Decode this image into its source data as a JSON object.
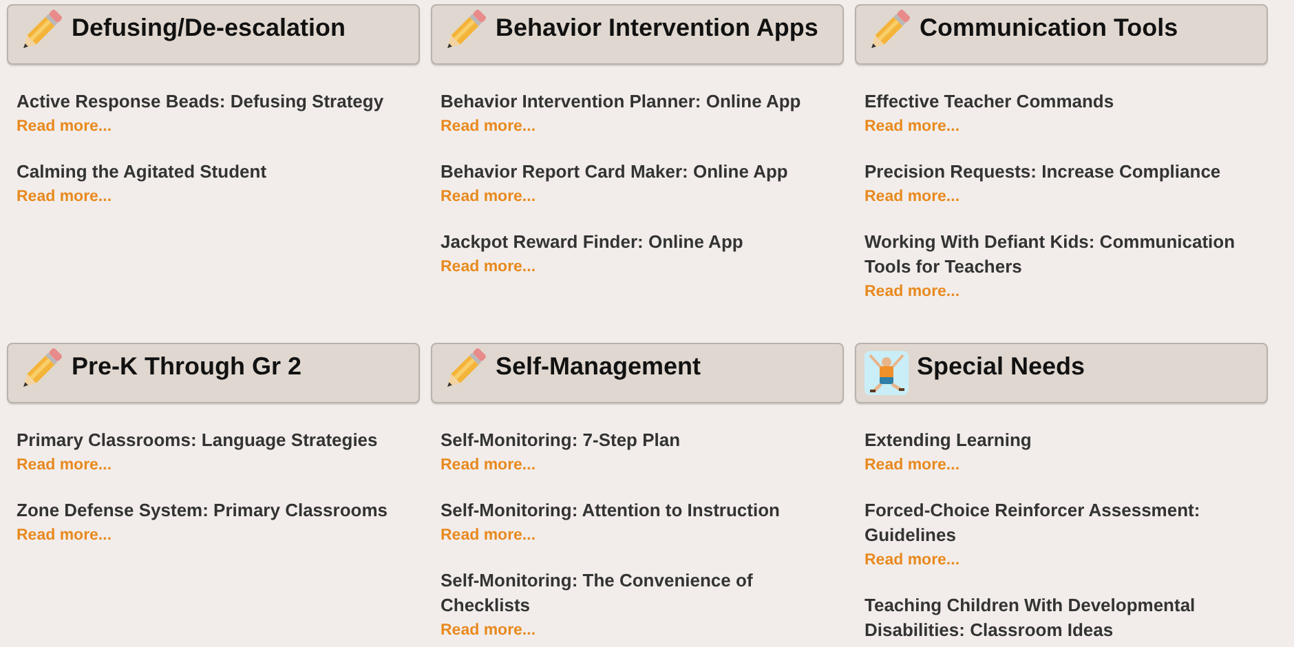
{
  "sections": [
    {
      "title": "Defusing/De-escalation",
      "kind": "pencil",
      "articles": [
        {
          "title": "Active Response Beads: Defusing Strategy",
          "link": "Read more..."
        },
        {
          "title": "Calming the Agitated Student",
          "link": "Read more..."
        }
      ]
    },
    {
      "title": "Behavior Intervention Apps",
      "kind": "pencil",
      "articles": [
        {
          "title": "Behavior Intervention Planner: Online App",
          "link": "Read more..."
        },
        {
          "title": "Behavior Report Card Maker: Online App",
          "link": "Read more..."
        },
        {
          "title": "Jackpot Reward Finder: Online App",
          "link": "Read more..."
        }
      ]
    },
    {
      "title": "Communication Tools",
      "kind": "pencil",
      "articles": [
        {
          "title": "Effective Teacher Commands",
          "link": "Read more..."
        },
        {
          "title": "Precision Requests: Increase Compliance",
          "link": "Read more..."
        },
        {
          "title": "Working With Defiant Kids: Communication Tools for Teachers",
          "link": "Read more..."
        }
      ]
    },
    {
      "title": "Pre-K Through Gr 2",
      "kind": "pencil",
      "articles": [
        {
          "title": "Primary Classrooms: Language Strategies",
          "link": "Read more..."
        },
        {
          "title": "Zone Defense System: Primary Classrooms",
          "link": "Read more..."
        }
      ]
    },
    {
      "title": "Self-Management",
      "kind": "pencil",
      "articles": [
        {
          "title": "Self-Monitoring: 7-Step Plan",
          "link": "Read more..."
        },
        {
          "title": "Self-Monitoring: Attention to Instruction",
          "link": "Read more..."
        },
        {
          "title": "Self-Monitoring: The Convenience of Checklists",
          "link": "Read more..."
        }
      ]
    },
    {
      "title": "Special Needs",
      "kind": "figure",
      "articles": [
        {
          "title": "Extending Learning",
          "link": "Read more..."
        },
        {
          "title": "Forced-Choice Reinforcer Assessment: Guidelines",
          "link": "Read more..."
        },
        {
          "title": "Teaching Children With Developmental Disabilities: Classroom Ideas"
        }
      ]
    }
  ]
}
